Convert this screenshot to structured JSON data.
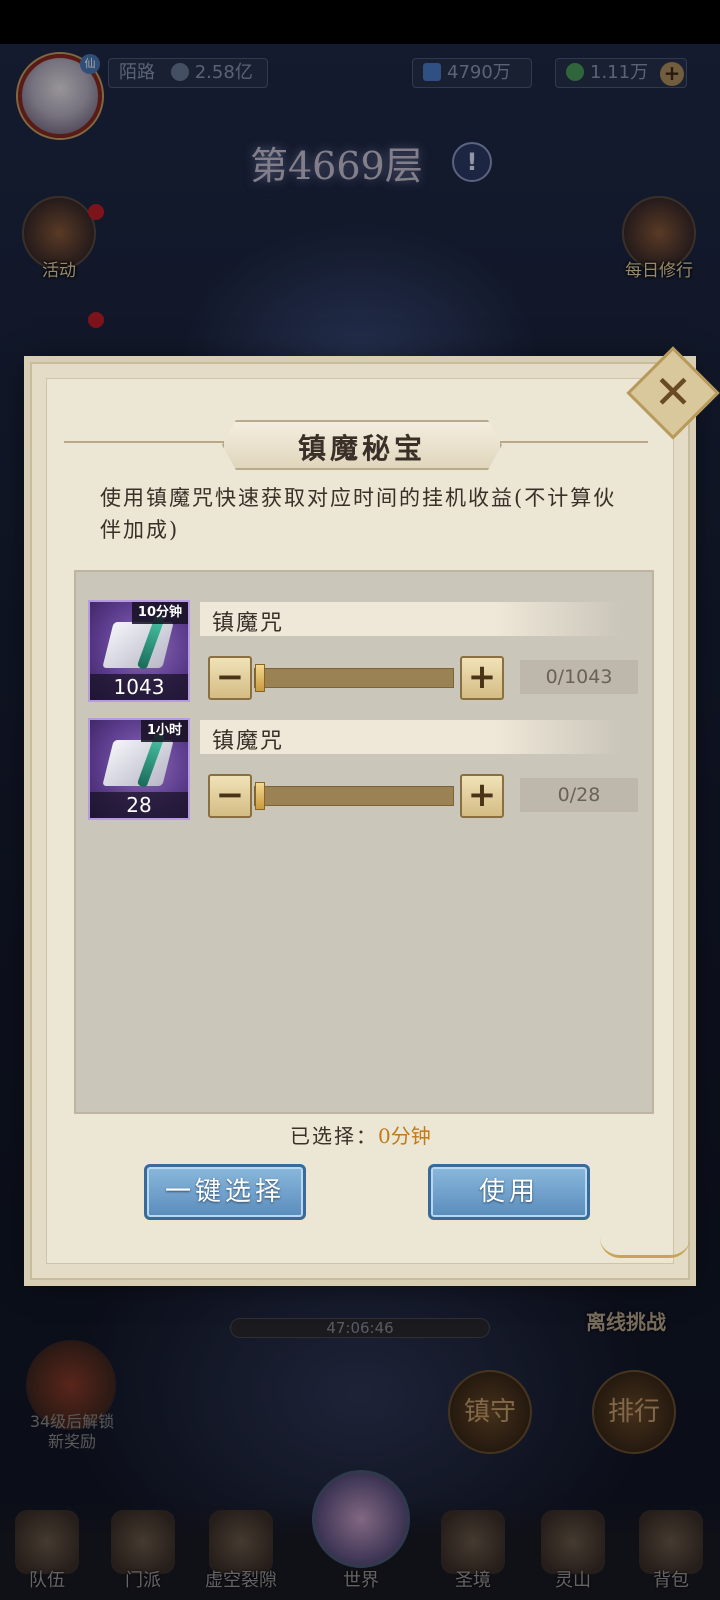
{
  "top": {
    "player_name": "陌路",
    "power": "2.58亿",
    "currency_gems": "4790万",
    "currency_jade": "1.11万"
  },
  "floor": {
    "title": "第4669层"
  },
  "side_left": [
    "活动"
  ],
  "side_right": [
    "每日修行"
  ],
  "bottom": {
    "timer": "47:06:46",
    "chest_text": "34级后解锁\n新奖励",
    "offline_label": "离线挑战",
    "round_buttons": [
      "镇守",
      "排行"
    ],
    "nav": [
      "队伍",
      "门派",
      "虚空裂隙",
      "世界",
      "圣境",
      "灵山",
      "背包"
    ]
  },
  "modal": {
    "title": "镇魔秘宝",
    "description": "使用镇魔咒快速获取对应时间的挂机收益(不计算伙伴加成)",
    "items": [
      {
        "tag": "10分钟",
        "count": "1043",
        "name": "镇魔咒",
        "qty": "0/1043",
        "slider": 0
      },
      {
        "tag": "1小时",
        "count": "28",
        "name": "镇魔咒",
        "qty": "0/28",
        "slider": 0
      }
    ],
    "selected_label": "已选择：",
    "selected_value": "0分钟",
    "btn_one_click": "一键选择",
    "btn_use": "使用"
  },
  "colors": {
    "accent_value": "#c07a18",
    "button_blue": "#5a8cbc",
    "item_purple": "#5a3a8a"
  }
}
